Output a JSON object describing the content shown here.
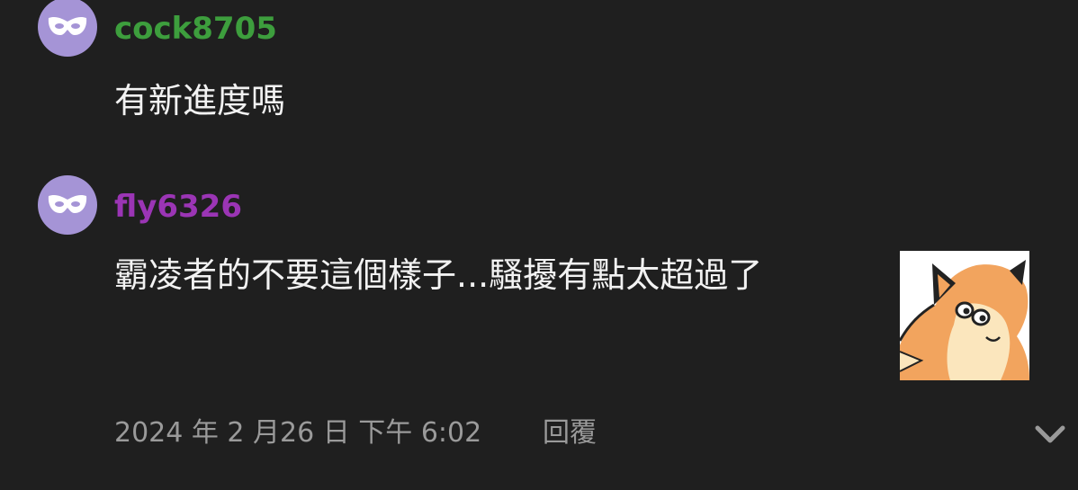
{
  "comments": [
    {
      "username": "cock8705",
      "username_color": "#3d9e3d",
      "avatar_icon": "mask-icon",
      "avatar_color": "#a594d6",
      "message": "有新進度嗎"
    },
    {
      "username": "fly6326",
      "username_color": "#9b35b5",
      "avatar_icon": "mask-icon",
      "avatar_color": "#a594d6",
      "message": "霸凌者的不要這個樣子...騷擾有點太超過了",
      "sticker": "fox-sticker"
    }
  ],
  "footer": {
    "timestamp": "2024 年 2 月26 日 下午 6:02",
    "reply_label": "回覆",
    "expand_icon": "chevron-down-icon"
  }
}
